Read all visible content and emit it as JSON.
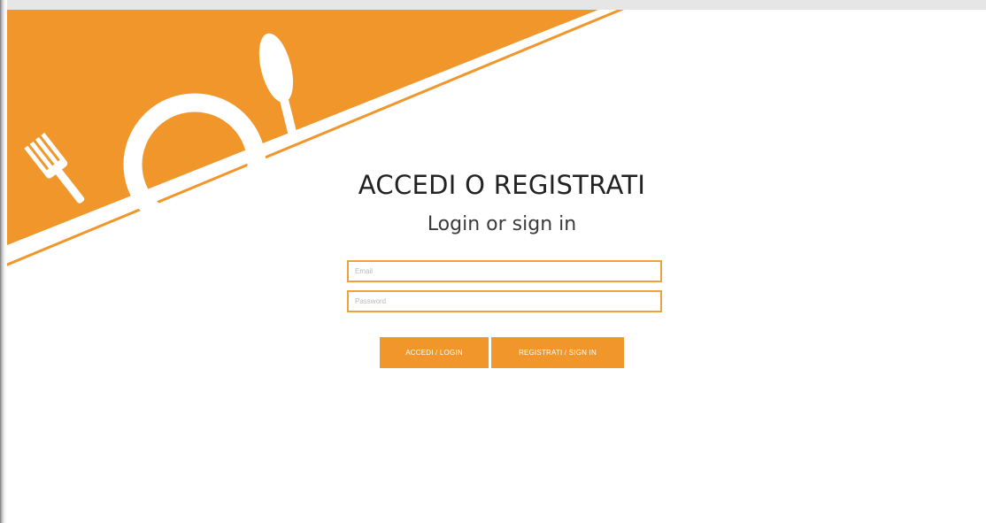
{
  "page": {
    "title": "ACCEDI O REGISTRATI",
    "subtitle": "Login or sign in"
  },
  "form": {
    "email_placeholder": "Email",
    "email_value": "",
    "password_placeholder": "Password",
    "password_value": ""
  },
  "buttons": {
    "login_label": "ACCEDI / LOGIN",
    "signin_label": "REGISTRATI / SIGN IN"
  },
  "colors": {
    "accent": "#f0962b",
    "field_border": "#f0a040"
  },
  "icons": [
    "fork-icon",
    "plate-icon",
    "spoon-icon"
  ]
}
